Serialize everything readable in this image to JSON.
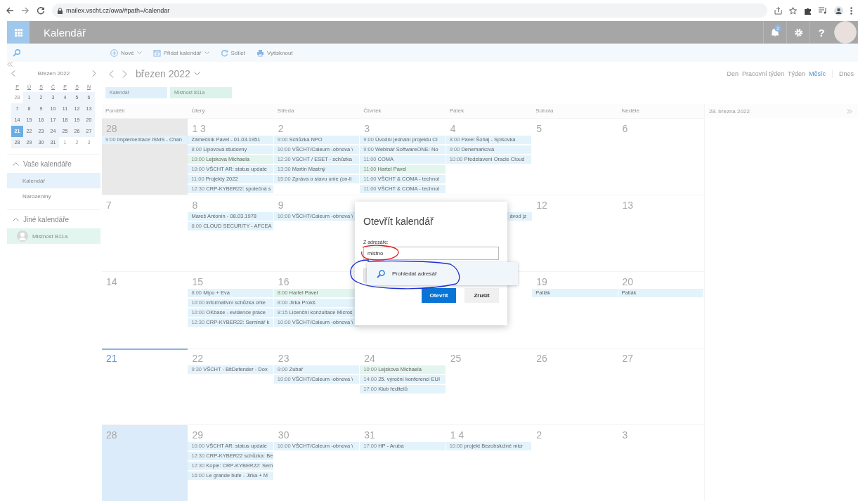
{
  "browser": {
    "url": "mailex.vscht.cz/owa/#path=/calendar"
  },
  "header": {
    "title": "Kalendář",
    "notifications": "2",
    "help": "?"
  },
  "toolbar": [
    {
      "label": "Nové",
      "kind": "new",
      "dropdown": true
    },
    {
      "label": "Přidat kalendář",
      "kind": "add",
      "dropdown": true
    },
    {
      "label": "Sdílet",
      "kind": "share",
      "dropdown": false
    },
    {
      "label": "Vytisknout",
      "kind": "print",
      "dropdown": false
    }
  ],
  "mini_calendar": {
    "title": "Březen 2022",
    "weekdays": [
      "P",
      "Ú",
      "S",
      "Č",
      "P",
      "S",
      "N"
    ],
    "weeks": [
      [
        {
          "d": "28",
          "muted": true,
          "selected": false
        },
        {
          "d": "1",
          "muted": false,
          "selected": false
        },
        {
          "d": "2",
          "muted": false,
          "selected": false
        },
        {
          "d": "3",
          "muted": false,
          "selected": false
        },
        {
          "d": "4",
          "muted": false,
          "selected": false
        },
        {
          "d": "5",
          "muted": false,
          "selected": false
        },
        {
          "d": "6",
          "muted": false,
          "selected": false
        }
      ],
      [
        {
          "d": "7",
          "muted": false,
          "selected": false
        },
        {
          "d": "8",
          "muted": false,
          "selected": false
        },
        {
          "d": "9",
          "muted": false,
          "selected": false
        },
        {
          "d": "10",
          "muted": false,
          "selected": false
        },
        {
          "d": "11",
          "muted": false,
          "selected": false
        },
        {
          "d": "12",
          "muted": false,
          "selected": false
        },
        {
          "d": "13",
          "muted": false,
          "selected": false
        }
      ],
      [
        {
          "d": "14",
          "muted": false,
          "selected": false
        },
        {
          "d": "15",
          "muted": false,
          "selected": false
        },
        {
          "d": "16",
          "muted": false,
          "selected": false
        },
        {
          "d": "17",
          "muted": false,
          "selected": false
        },
        {
          "d": "18",
          "muted": false,
          "selected": false
        },
        {
          "d": "19",
          "muted": false,
          "selected": false
        },
        {
          "d": "20",
          "muted": false,
          "selected": false
        }
      ],
      [
        {
          "d": "21",
          "muted": false,
          "selected": true
        },
        {
          "d": "22",
          "muted": false,
          "selected": false
        },
        {
          "d": "23",
          "muted": false,
          "selected": false
        },
        {
          "d": "24",
          "muted": false,
          "selected": false
        },
        {
          "d": "25",
          "muted": false,
          "selected": false
        },
        {
          "d": "26",
          "muted": false,
          "selected": false
        },
        {
          "d": "27",
          "muted": false,
          "selected": false
        }
      ],
      [
        {
          "d": "28",
          "muted": false,
          "selected": false
        },
        {
          "d": "29",
          "muted": false,
          "selected": false
        },
        {
          "d": "30",
          "muted": false,
          "selected": false
        },
        {
          "d": "31",
          "muted": false,
          "selected": false
        },
        {
          "d": "1",
          "muted": true,
          "selected": false
        },
        {
          "d": "2",
          "muted": true,
          "selected": false
        },
        {
          "d": "3",
          "muted": true,
          "selected": false
        }
      ]
    ]
  },
  "sidebar": {
    "groups": [
      {
        "title": "Vaše kalendáře",
        "expanded": true,
        "items": [
          {
            "label": "Kalendář",
            "selected": true,
            "avatar": false
          },
          {
            "label": "Narozeniny",
            "selected": false,
            "avatar": false
          }
        ]
      },
      {
        "title": "Jiné kalendáře",
        "expanded": true,
        "items": [
          {
            "label": "Mistnost B11a",
            "selected": true,
            "avatar": true
          }
        ]
      }
    ]
  },
  "calendar": {
    "title": "březen 2022",
    "views": [
      {
        "label": "Den",
        "selected": false
      },
      {
        "label": "Pracovní týden",
        "selected": false
      },
      {
        "label": "Týden",
        "selected": false
      },
      {
        "label": "Měsíc",
        "selected": true
      }
    ],
    "today_label": "Dnes",
    "chips": [
      {
        "label": "Kalendář",
        "color": "#dff0fb"
      },
      {
        "label": "Mistnost 811a",
        "color": "#dcf3ec"
      }
    ],
    "weekdays": [
      "Pondělí",
      "Úterý",
      "Středa",
      "Čtvrtek",
      "Pátek",
      "Sobota",
      "Neděle"
    ],
    "side_panel": {
      "title": "28. března 2022"
    },
    "weeks": [
      {
        "mon": {
          "d": "28",
          "shaded": true,
          "today": false,
          "selected": false,
          "events": [
            {
              "time": "9:00",
              "title": "Implementace ISMS - Chan",
              "color": "#e3f3fc"
            }
          ]
        },
        "tue": {
          "d": "1 3",
          "shaded": false,
          "today": false,
          "selected": false,
          "events": [
            {
              "title": "Zámečník Pavel - 01.03.1951",
              "color": "#e3f3fc"
            },
            {
              "time": "8:00",
              "title": "Lipovová studovny",
              "color": "#e3f3fc"
            },
            {
              "time": "10:00",
              "title": "Lejskova Michaela",
              "color": "#e2f5ef"
            },
            {
              "time": "10:00",
              "title": "VŠCHT AR: status update",
              "color": "#e3f3fc"
            },
            {
              "time": "11:00",
              "title": "Projekty 2022",
              "color": "#e3f3fc"
            },
            {
              "time": "12:30",
              "title": "CRP-KYBER22: společná s",
              "color": "#e3f3fc"
            }
          ]
        },
        "wed": {
          "d": "2",
          "shaded": false,
          "today": false,
          "selected": false,
          "events": [
            {
              "time": "9:00",
              "title": "Schůzka NPO",
              "color": "#e3f3fc"
            },
            {
              "time": "10:00",
              "title": "VŠCHT/Caleum -obnova \\",
              "color": "#e3f3fc"
            },
            {
              "time": "12:30",
              "title": "VSCHT / ESET - schůzka",
              "color": "#e3f3fc"
            },
            {
              "time": "13:30",
              "title": "Martin Mastný",
              "color": "#e3f3fc"
            },
            {
              "time": "15:00",
              "title": "Zpráva o stavu unie (on-li",
              "color": "#e3f3fc"
            }
          ]
        },
        "thu": {
          "d": "3",
          "shaded": false,
          "today": false,
          "selected": false,
          "events": [
            {
              "time": "9:00",
              "title": "Úvodní jednání projektu CI",
              "color": "#e3f3fc"
            },
            {
              "time": "9:00",
              "title": "Webinář SoftwareONE: No",
              "color": "#e3f3fc"
            },
            {
              "time": "11:00",
              "title": "COMA",
              "color": "#e3f3fc"
            },
            {
              "time": "11:00",
              "title": "Hartel Pavel",
              "color": "#e2f5ef"
            },
            {
              "time": "11:00",
              "title": "VŠCHT & COMA - technol",
              "color": "#e3f3fc"
            },
            {
              "time": "11:00",
              "title": "VŠCHT & COMA - technol",
              "color": "#e3f3fc"
            }
          ]
        },
        "fri": {
          "d": "4",
          "shaded": false,
          "today": false,
          "selected": false,
          "events": [
            {
              "time": "8:00",
              "title": "Pavel Šohaj - Spisovka",
              "color": "#e3f3fc"
            },
            {
              "time": "9:00",
              "title": "Denemarková",
              "color": "#e3f3fc"
            },
            {
              "time": "10:00",
              "title": "Představení Oracle Cloud",
              "color": "#e3f3fc"
            }
          ]
        },
        "sat": {
          "d": "5",
          "shaded": false,
          "today": false,
          "selected": false
        },
        "sun": {
          "d": "6",
          "shaded": false,
          "today": false,
          "selected": false
        }
      },
      {
        "mon": {
          "d": "7",
          "shaded": false,
          "today": false,
          "selected": false
        },
        "tue": {
          "d": "8",
          "shaded": false,
          "today": false,
          "selected": false,
          "events": [
            {
              "title": "Mareš Antonín - 08.03.1978",
              "color": "#e3f3fc"
            },
            {
              "time": "8:00",
              "title": "CLOUD SECURITY - AFCEA",
              "color": "#e3f3fc"
            }
          ]
        },
        "wed": {
          "d": "9",
          "shaded": false,
          "today": false,
          "selected": false,
          "events": [
            {
              "time": "10:00",
              "title": "VŠCHT/Caleum -obnova \\",
              "color": "#e3f3fc"
            }
          ]
        },
        "fri": {
          "peek": "ávod jz"
        },
        "sat": {
          "d": "12",
          "shaded": false,
          "today": false,
          "selected": false
        },
        "sun": {
          "d": "13",
          "shaded": false,
          "today": false,
          "selected": false
        }
      },
      {
        "mon": {
          "d": "14",
          "shaded": false,
          "today": false,
          "selected": false
        },
        "tue": {
          "d": "15",
          "shaded": false,
          "today": false,
          "selected": false,
          "events": [
            {
              "time": "8:00",
              "title": "Mipo + Eva",
              "color": "#e3f3fc"
            },
            {
              "time": "10:00",
              "title": "informativní schůzka ohle",
              "color": "#e3f3fc"
            },
            {
              "time": "10:00",
              "title": "OKbase - evidence práce",
              "color": "#e3f3fc"
            },
            {
              "time": "12:30",
              "title": "CRP-KYBER22: Seminář k",
              "color": "#e3f3fc"
            }
          ]
        },
        "wed": {
          "d": "16",
          "shaded": false,
          "today": false,
          "selected": false,
          "events": [
            {
              "time": "8:00",
              "title": "Hartel Pavel",
              "color": "#e2f5ef"
            },
            {
              "time": "8:00",
              "title": "Jirka Prokš",
              "color": "#e3f3fc"
            },
            {
              "time": "8:15",
              "title": "Licenční konzultace Micros",
              "color": "#e3f3fc"
            },
            {
              "time": "10:00",
              "title": "VŠCHT/Caleum -obnova \\",
              "color": "#e3f3fc"
            }
          ]
        },
        "sat": {
          "d": "19",
          "shaded": false,
          "today": false,
          "selected": false,
          "events": [
            {
              "title": "Patlák",
              "color": "#e3f3fc"
            }
          ]
        },
        "sun": {
          "d": "20",
          "shaded": false,
          "today": false,
          "selected": false,
          "events": [
            {
              "title": "Patlák",
              "color": "#e3f3fc"
            }
          ]
        }
      },
      {
        "mon": {
          "d": "21",
          "shaded": false,
          "today": true,
          "selected": false
        },
        "tue": {
          "d": "22",
          "shaded": false,
          "today": false,
          "selected": false,
          "events": [
            {
              "time": "9:30",
              "title": "VŠCHT - BitDefender - Dox",
              "color": "#e3f3fc"
            }
          ]
        },
        "wed": {
          "d": "23",
          "shaded": false,
          "today": false,
          "selected": false,
          "events": [
            {
              "time": "9:00",
              "title": "Zubař",
              "color": "#e3f3fc"
            },
            {
              "time": "10:00",
              "title": "VŠCHT/Caleum -obnova \\",
              "color": "#e3f3fc"
            }
          ]
        },
        "thu": {
          "d": "24",
          "shaded": false,
          "today": false,
          "selected": false,
          "events": [
            {
              "time": "10:00",
              "title": "Lejskova Michaela",
              "color": "#e2f5ef"
            },
            {
              "time": "14:00",
              "title": "25. výroční konferenci EUI",
              "color": "#e3f3fc"
            },
            {
              "time": "17:00",
              "title": "Klub ředitelů",
              "color": "#e3f3fc"
            }
          ]
        },
        "fri": {
          "d": "25",
          "shaded": false,
          "today": false,
          "selected": false
        },
        "sat": {
          "d": "26",
          "shaded": false,
          "today": false,
          "selected": false
        },
        "sun": {
          "d": "27",
          "shaded": false,
          "today": false,
          "selected": false
        }
      },
      {
        "mon": {
          "d": "28",
          "shaded": false,
          "today": false,
          "selected": true
        },
        "tue": {
          "d": "29",
          "shaded": false,
          "today": false,
          "selected": false,
          "events": [
            {
              "time": "10:00",
              "title": "VŠCHT AR: status update",
              "color": "#e3f3fc"
            },
            {
              "time": "12:30",
              "title": "CRP-KYBER22 schůzka: Be",
              "color": "#e3f3fc"
            },
            {
              "time": "12:30",
              "title": "Kopie: CRP-KYBER22: Sem",
              "color": "#e3f3fc"
            },
            {
              "time": "16:00",
              "title": "Le grande bufe - Jirka + M",
              "color": "#e3f3fc"
            }
          ]
        },
        "wed": {
          "d": "30",
          "shaded": false,
          "today": false,
          "selected": false,
          "events": [
            {
              "time": "10:00",
              "title": "VŠCHT/Caleum -obnova \\",
              "color": "#e3f3fc"
            }
          ]
        },
        "thu": {
          "d": "31",
          "shaded": false,
          "today": false,
          "selected": false,
          "events": [
            {
              "time": "17:00",
              "title": "HP - Aruba",
              "color": "#e3f3fc"
            }
          ]
        },
        "fri": {
          "d": "1 4",
          "shaded": false,
          "today": false,
          "selected": false,
          "events": [
            {
              "time": "10:00",
              "title": "projekt Bezobslužné micr",
              "color": "#e3f3fc"
            }
          ]
        },
        "sat": {
          "d": "2",
          "shaded": false,
          "today": false,
          "selected": false
        },
        "sun": {
          "d": "3",
          "shaded": false,
          "today": false,
          "selected": false
        }
      }
    ]
  },
  "dialog": {
    "title": "Otevřít kalendář",
    "label": "Z adresáře:",
    "value": "mistno",
    "suggestion": "Prohledat adresář",
    "buttons": [
      {
        "label": "Otevřít",
        "primary": true
      },
      {
        "label": "Zrušit",
        "primary": false
      }
    ]
  }
}
